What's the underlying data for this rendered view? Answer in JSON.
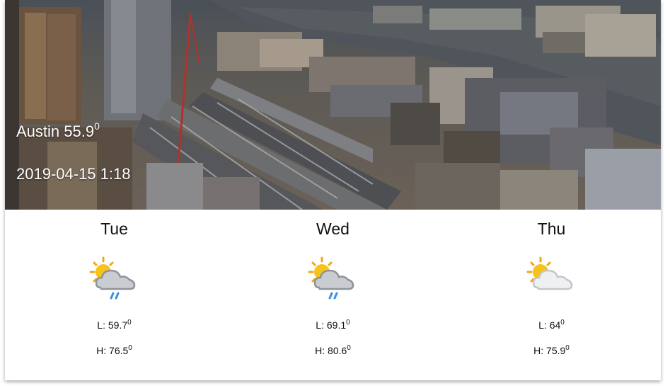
{
  "current": {
    "city": "Austin",
    "temperature": "55.9",
    "degree_mark": "0",
    "datetime": "2019-04-15 1:18"
  },
  "forecast": [
    {
      "day": "Tue",
      "icon": "partly-cloudy-rain-icon",
      "low_label": "L: ",
      "low": "59.7",
      "high_label": "H: ",
      "high": "76.5",
      "degree_mark": "0"
    },
    {
      "day": "Wed",
      "icon": "partly-cloudy-rain-icon",
      "low_label": "L: ",
      "low": "69.1",
      "high_label": "H: ",
      "high": "80.6",
      "degree_mark": "0"
    },
    {
      "day": "Thu",
      "icon": "partly-cloudy-icon",
      "low_label": "L: ",
      "low": "64",
      "high_label": "H: ",
      "high": "75.9",
      "degree_mark": "0"
    }
  ],
  "colors": {
    "sun": "#f7c21a",
    "sun_rays": "#f4a516",
    "cloud_dark": "#c9ccd0",
    "cloud_light": "#eef0f2",
    "rain": "#3b8fe0",
    "text": "#111111"
  }
}
